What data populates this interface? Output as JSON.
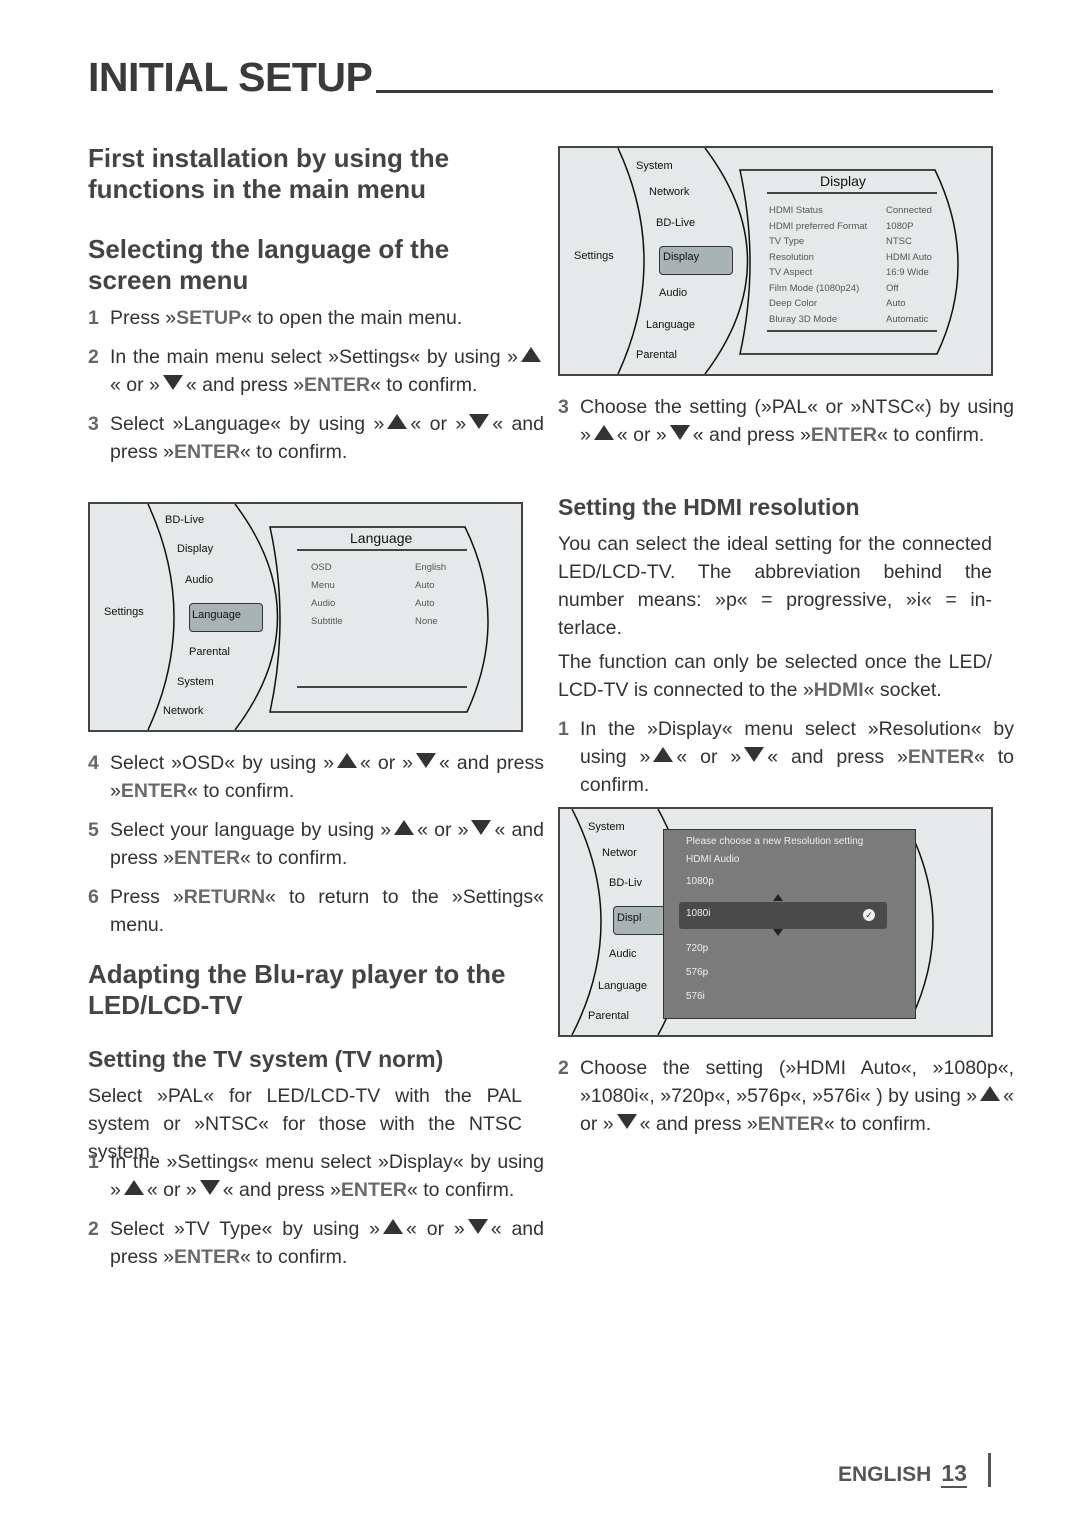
{
  "title": "INITIAL SETUP",
  "left": {
    "h_first": "First installation by using the functions in the main menu",
    "h_lang": "Selecting the language of the screen menu",
    "steps_a": [
      {
        "num": "1",
        "parts": [
          {
            "t": "Press »"
          },
          {
            "k": "SETUP"
          },
          {
            "t": "« to open the main menu."
          }
        ]
      },
      {
        "num": "2",
        "parts": [
          {
            "t": "In the main menu select »Settings« by using »"
          },
          {
            "i": "up"
          },
          {
            "t": "« or »"
          },
          {
            "i": "down"
          },
          {
            "t": "« and press »"
          },
          {
            "k": "ENTER"
          },
          {
            "t": "« to con­firm."
          }
        ]
      },
      {
        "num": "3",
        "parts": [
          {
            "t": "Select »Language« by using »"
          },
          {
            "i": "up"
          },
          {
            "t": "« or »"
          },
          {
            "i": "down"
          },
          {
            "t": "« and press »"
          },
          {
            "k": "ENTER"
          },
          {
            "t": "« to confirm."
          }
        ]
      }
    ],
    "steps_b": [
      {
        "num": "4",
        "parts": [
          {
            "t": "Select »OSD« by using »"
          },
          {
            "i": "up"
          },
          {
            "t": "« or »"
          },
          {
            "i": "down"
          },
          {
            "t": "« and press »"
          },
          {
            "k": "ENTER"
          },
          {
            "t": "« to confirm."
          }
        ]
      },
      {
        "num": "5",
        "parts": [
          {
            "t": "Select your language by using »"
          },
          {
            "i": "up"
          },
          {
            "t": "« or »"
          },
          {
            "i": "down"
          },
          {
            "t": "« and press »"
          },
          {
            "k": "ENTER"
          },
          {
            "t": "« to confirm."
          }
        ]
      },
      {
        "num": "6",
        "parts": [
          {
            "t": "Press »"
          },
          {
            "k": "RETURN"
          },
          {
            "t": "« to return to the »Settings« menu."
          }
        ]
      }
    ],
    "h_adapt": "Adapting the Blu-ray player to the LED/LCD-TV",
    "h_tv": "Setting the TV system (TV norm)",
    "p_tv": "Select »PAL« for LED/LCD-TV with the PAL system or »NTSC« for those with the NTSC system.",
    "steps_c": [
      {
        "num": "1",
        "parts": [
          {
            "t": "In the »Settings« menu select »Display« by using »"
          },
          {
            "i": "up"
          },
          {
            "t": "« or »"
          },
          {
            "i": "down"
          },
          {
            "t": "« and press »"
          },
          {
            "k": "ENTER"
          },
          {
            "t": "« to confirm."
          }
        ]
      },
      {
        "num": "2",
        "parts": [
          {
            "t": "Select »TV Type« by using »"
          },
          {
            "i": "up"
          },
          {
            "t": "« or »"
          },
          {
            "i": "down"
          },
          {
            "t": "« and press »"
          },
          {
            "k": "ENTER"
          },
          {
            "t": "« to confirm."
          }
        ]
      }
    ]
  },
  "right": {
    "steps_a": [
      {
        "num": "3",
        "parts": [
          {
            "t": "Choose the setting (»PAL« or »NTSC«) by using »"
          },
          {
            "i": "up"
          },
          {
            "t": "« or »"
          },
          {
            "i": "down"
          },
          {
            "t": "« and press »"
          },
          {
            "k": "ENTER"
          },
          {
            "t": "« to con­firm."
          }
        ]
      }
    ],
    "h_hdmi": "Setting the HDMI resolution",
    "p1": "You can select the ideal setting for the con­nected LED/LCD-TV. The abbreviation behind the number means: »p« = progressive, »i« = in­terlace.",
    "p2_parts": [
      {
        "t": "The function can only be selected once the LED/ LCD-TV is connected to the »"
      },
      {
        "k": "HDMI"
      },
      {
        "t": "« socket."
      }
    ],
    "steps_b": [
      {
        "num": "1",
        "parts": [
          {
            "t": "In the »Display« menu select »Resolution« by using »"
          },
          {
            "i": "up"
          },
          {
            "t": "« or »"
          },
          {
            "i": "down"
          },
          {
            "t": "« and press »"
          },
          {
            "k": "ENTER"
          },
          {
            "t": "« to confirm."
          }
        ]
      }
    ],
    "steps_c": [
      {
        "num": "2",
        "parts": [
          {
            "t": "Choose the setting (»HDMI Auto«, »1080p«, »1080i«, »720p«, »576p«, »576i« ) by using »"
          },
          {
            "i": "up"
          },
          {
            "t": "« or »"
          },
          {
            "i": "down"
          },
          {
            "t": "« and press »"
          },
          {
            "k": "ENTER"
          },
          {
            "t": "« to con­firm."
          }
        ]
      }
    ]
  },
  "screen1": {
    "settings": "Settings",
    "menu": [
      "BD-Live",
      "Display",
      "Audio",
      "Language",
      "Parental",
      "System",
      "Network"
    ],
    "panel_title": "Language",
    "rows": [
      {
        "label": "OSD",
        "value": "English"
      },
      {
        "label": "Menu",
        "value": "Auto"
      },
      {
        "label": "Audio",
        "value": "Auto"
      },
      {
        "label": "Subtitle",
        "value": "None"
      }
    ]
  },
  "screen2": {
    "settings": "Settings",
    "menu": [
      "System",
      "Network",
      "BD-Live",
      "Display",
      "Audio",
      "Language",
      "Parental"
    ],
    "panel_title": "Display",
    "rows": [
      {
        "label": "HDMI Status",
        "value": "Connected"
      },
      {
        "label": "HDMI preferred Format",
        "value": "1080P"
      },
      {
        "label": "TV Type",
        "value": "NTSC"
      },
      {
        "label": "Resolution",
        "value": "HDMI Auto"
      },
      {
        "label": "TV Aspect",
        "value": "16:9 Wide"
      },
      {
        "label": "Film Mode (1080p24)",
        "value": "Off"
      },
      {
        "label": "Deep Color",
        "value": "Auto"
      },
      {
        "label": "Bluray 3D Mode",
        "value": "Automatic"
      }
    ]
  },
  "screen3": {
    "menu": [
      "System",
      "Networ",
      "BD-Liv",
      "Displ",
      "Audic",
      "Language",
      "Parental"
    ],
    "prompt": "Please choose a new Resolution setting",
    "options": [
      "HDMI Audio",
      "1080p",
      "1080i",
      "720p",
      "576p",
      "576i"
    ],
    "selected": "1080i"
  },
  "footer": {
    "language": "ENGLISH",
    "page": "13"
  }
}
